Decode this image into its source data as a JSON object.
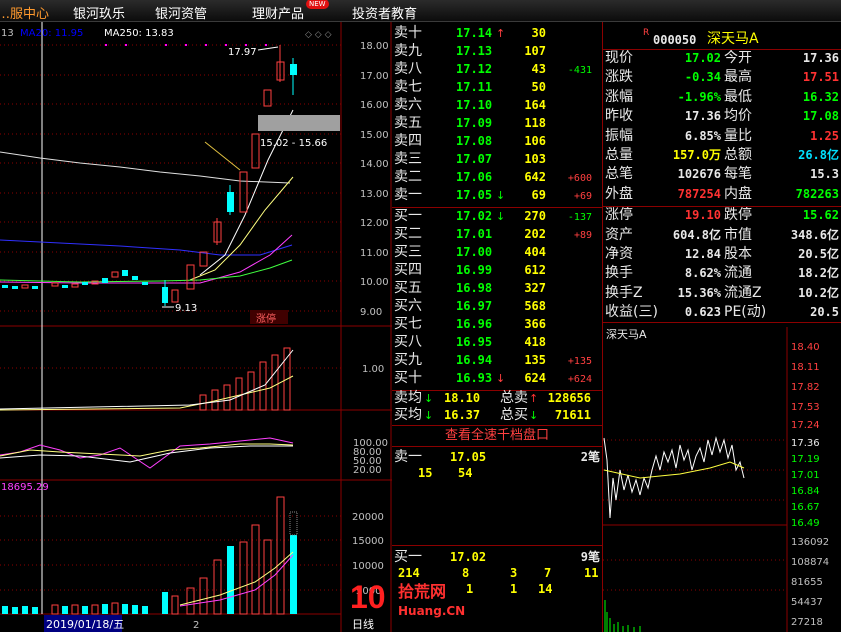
{
  "menu": {
    "items": [
      "…服中心",
      "银河玖乐",
      "银河资管",
      "理财产品",
      "投资者教育"
    ],
    "new_badge": "NEW"
  },
  "chart": {
    "header_left": "13",
    "ma_label": "MA250: 13.83",
    "price_axis": [
      "18.00",
      "17.00",
      "16.00",
      "15.00",
      "14.00",
      "13.00",
      "12.00",
      "11.00",
      "10.00",
      "9.00"
    ],
    "high_mark": "17.97",
    "low_mark": "9.13",
    "range_box": "15.02 - 15.66",
    "limit_up_tag": "涨停",
    "vol_axis": [
      "1.00"
    ],
    "osc_axis": [
      "100.00",
      "80.00",
      "50.00",
      "20.00"
    ],
    "amt_label": "18695.29",
    "amt_axis": [
      "20000",
      "15000",
      "10000",
      "5000"
    ],
    "date_label": "2019/01/18/五",
    "footer_num": "2",
    "footer_label": "日线"
  },
  "orderbook": {
    "sells": [
      {
        "label": "卖十",
        "price": "17.14",
        "vol": "30",
        "chg": ""
      },
      {
        "label": "卖九",
        "price": "17.13",
        "vol": "107",
        "chg": ""
      },
      {
        "label": "卖八",
        "price": "17.12",
        "vol": "43",
        "chg": "-431"
      },
      {
        "label": "卖七",
        "price": "17.11",
        "vol": "50",
        "chg": ""
      },
      {
        "label": "卖六",
        "price": "17.10",
        "vol": "164",
        "chg": ""
      },
      {
        "label": "卖五",
        "price": "17.09",
        "vol": "118",
        "chg": ""
      },
      {
        "label": "卖四",
        "price": "17.08",
        "vol": "106",
        "chg": ""
      },
      {
        "label": "卖三",
        "price": "17.07",
        "vol": "103",
        "chg": ""
      },
      {
        "label": "卖二",
        "price": "17.06",
        "vol": "642",
        "chg": "+600"
      },
      {
        "label": "卖一",
        "price": "17.05",
        "vol": "69",
        "chg": "+69"
      }
    ],
    "buys": [
      {
        "label": "买一",
        "price": "17.02",
        "vol": "270",
        "chg": "-137"
      },
      {
        "label": "买二",
        "price": "17.01",
        "vol": "202",
        "chg": "+89"
      },
      {
        "label": "买三",
        "price": "17.00",
        "vol": "404",
        "chg": ""
      },
      {
        "label": "买四",
        "price": "16.99",
        "vol": "612",
        "chg": ""
      },
      {
        "label": "买五",
        "price": "16.98",
        "vol": "327",
        "chg": ""
      },
      {
        "label": "买六",
        "price": "16.97",
        "vol": "568",
        "chg": ""
      },
      {
        "label": "买七",
        "price": "16.96",
        "vol": "366",
        "chg": ""
      },
      {
        "label": "买八",
        "price": "16.95",
        "vol": "418",
        "chg": ""
      },
      {
        "label": "买九",
        "price": "16.94",
        "vol": "135",
        "chg": "+135"
      },
      {
        "label": "买十",
        "price": "16.93",
        "vol": "624",
        "chg": "+624"
      }
    ],
    "avg_sell_label": "卖均",
    "avg_sell": "18.10",
    "total_sell_label": "总卖",
    "total_sell": "128656",
    "avg_buy_label": "买均",
    "avg_buy": "16.37",
    "total_buy_label": "总买",
    "total_buy": "71611",
    "view_button": "查看全速千档盘口",
    "ask1_label": "卖一",
    "ask1_price": "17.05",
    "ask1_count": "2笔",
    "ask1_q1": "15",
    "ask1_q2": "54",
    "bid1_label": "买一",
    "bid1_price": "17.02",
    "bid1_count": "9笔",
    "bid1_row1": [
      "214",
      "8",
      "3",
      "7",
      "11"
    ],
    "bid1_row2": [
      "",
      "1",
      "1",
      "14",
      ""
    ]
  },
  "quote": {
    "r_badge": "R",
    "code": "000050",
    "name": "深天马A",
    "rows": [
      [
        "现价",
        "17.02",
        "今开",
        "17.36"
      ],
      [
        "涨跌",
        "-0.34",
        "最高",
        "17.51"
      ],
      [
        "涨幅",
        "-1.96%",
        "最低",
        "16.32"
      ],
      [
        "昨收",
        "17.36",
        "均价",
        "17.08"
      ],
      [
        "振幅",
        "6.85%",
        "量比",
        "1.25"
      ],
      [
        "总量",
        "157.0万",
        "总额",
        "26.8亿"
      ],
      [
        "总笔",
        "102676",
        "每笔",
        "15.3"
      ],
      [
        "外盘",
        "787254",
        "内盘",
        "782263"
      ],
      [
        "涨停",
        "19.10",
        "跌停",
        "15.62"
      ],
      [
        "资产",
        "604.8亿",
        "市值",
        "348.6亿"
      ],
      [
        "净资",
        "12.84",
        "股本",
        "20.5亿"
      ],
      [
        "换手",
        "8.62%",
        "流通",
        "18.2亿"
      ],
      [
        "换手Z",
        "15.36%",
        "流通Z",
        "10.2亿"
      ],
      [
        "收益(三)",
        "0.623",
        "PE(动)",
        "20.5"
      ]
    ],
    "colors": [
      [
        "#00ff00",
        "#e8e8e8"
      ],
      [
        "#00ff00",
        "#ff3232"
      ],
      [
        "#00ff00",
        "#00ff00"
      ],
      [
        "#e8e8e8",
        "#00ff00"
      ],
      [
        "#e8e8e8",
        "#ff3232"
      ],
      [
        "#ffff00",
        "#00e0ff"
      ],
      [
        "#e8e8e8",
        "#e8e8e8"
      ],
      [
        "#ff3232",
        "#00ff00"
      ],
      [
        "#ff3232",
        "#00ff00"
      ],
      [
        "#e8e8e8",
        "#e8e8e8"
      ],
      [
        "#e8e8e8",
        "#e8e8e8"
      ],
      [
        "#e8e8e8",
        "#e8e8e8"
      ],
      [
        "#e8e8e8",
        "#e8e8e8"
      ],
      [
        "#e8e8e8",
        "#e8e8e8"
      ]
    ]
  },
  "intraday": {
    "title": "深天马A",
    "price_axis": [
      "18.40",
      "18.11",
      "17.82",
      "17.53",
      "17.24",
      "17.36",
      "17.19",
      "17.01",
      "16.84",
      "16.67",
      "16.49"
    ],
    "vol_axis": [
      "136092",
      "108874",
      "81655",
      "54437",
      "27218"
    ]
  },
  "watermark": {
    "text": "拾荒网",
    "sub": "Huang.CN"
  }
}
